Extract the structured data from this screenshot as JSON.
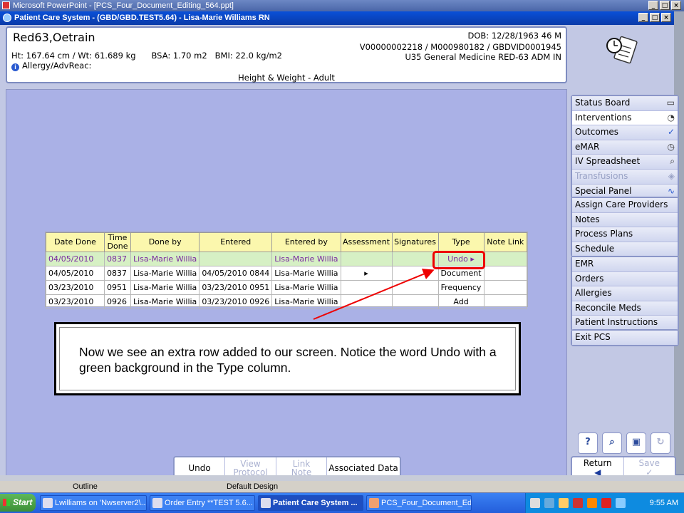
{
  "ppt_window": {
    "title": "Microsoft PowerPoint - [PCS_Four_Document_Editing_564.ppt]",
    "status_outline": "Outline",
    "status_design": "Default Design"
  },
  "app_window": {
    "title": "Patient Care System - (GBD/GBD.TEST5.64) - Lisa-Marie Williams RN"
  },
  "patient": {
    "name": "Red63,Oetrain",
    "vitals": "Ht: 167.64 cm / Wt: 61.689 kg      BSA: 1.70 m2   BMI: 22.0 kg/m2",
    "allergy": "Allergy/AdvReac:",
    "dob": "DOB: 12/28/1963 46 M",
    "visit_ids": "V00000002218 / M000980182 / GBDVID0001945",
    "unit": "U35 General Medicine  RED-63  ADM IN",
    "screen_name": "Height & Weight - Adult"
  },
  "table": {
    "headers": [
      "Date Done",
      "Time Done",
      "Done by",
      "Entered",
      "Entered by",
      "Assessment",
      "Signatures",
      "Type",
      "Note Link"
    ],
    "rows": [
      [
        "04/05/2010",
        "0837",
        "Lisa-Marie Willia",
        "",
        "Lisa-Marie Willia",
        "",
        "",
        "Undo ▸",
        ""
      ],
      [
        "04/05/2010",
        "0837",
        "Lisa-Marie Willia",
        "04/05/2010 0844",
        "Lisa-Marie Willia",
        "▸",
        "",
        "Document",
        ""
      ],
      [
        "03/23/2010",
        "0951",
        "Lisa-Marie Willia",
        "03/23/2010 0951",
        "Lisa-Marie Willia",
        "",
        "",
        "Frequency",
        ""
      ],
      [
        "03/23/2010",
        "0926",
        "Lisa-Marie Willia",
        "03/23/2010 0926",
        "Lisa-Marie Willia",
        "",
        "",
        "Add",
        ""
      ]
    ]
  },
  "callout": {
    "text": "Now we see an extra row added to our screen. Notice the word Undo with a green background in the Type column."
  },
  "nav": {
    "group1": [
      "Status Board",
      "Interventions",
      "Outcomes",
      "eMAR",
      "IV Spreadsheet",
      "Transfusions",
      "Special Panel"
    ],
    "group2": [
      "Assign Care Providers",
      "Notes",
      "Process Plans",
      "Schedule"
    ],
    "group3": [
      "EMR",
      "Orders",
      "Allergies",
      "Reconcile Meds",
      "Patient Instructions"
    ],
    "group4": [
      "Exit PCS"
    ]
  },
  "bottom_bar": {
    "undo": "Undo",
    "view_protocol_1": "View",
    "view_protocol_2": "Protocol",
    "link_note_1": "Link",
    "link_note_2": "Note",
    "associated_data": "Associated Data",
    "return": "Return",
    "save": "Save"
  },
  "taskbar": {
    "start": "Start",
    "tasks": [
      "Lwilliams on 'Nwserver2\\...",
      "Order Entry **TEST 5.6...",
      "Patient Care System ...",
      "PCS_Four_Document_Ed..."
    ],
    "clock": "9:55 AM"
  },
  "colors": {
    "undo_row_bg": "#d6f0c4",
    "undo_row_text": "#7a2aa0",
    "highlight": "#e00000",
    "header_row_bg": "#fbf7ad"
  }
}
